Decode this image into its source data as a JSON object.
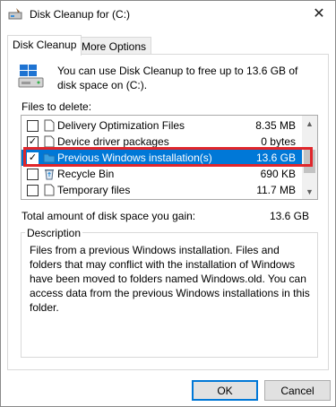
{
  "window": {
    "title": "Disk Cleanup for  (C:)",
    "close_glyph": "✕"
  },
  "tabs": [
    {
      "label": "Disk Cleanup",
      "active": true
    },
    {
      "label": "More Options",
      "active": false
    }
  ],
  "intro": {
    "icon": "disk-cleanup-drive-icon",
    "text": "You can use Disk Cleanup to free up to 13.6 GB of disk space on  (C:)."
  },
  "files_label": "Files to delete:",
  "files": [
    {
      "name": "Delivery Optimization Files",
      "size": "8.35 MB",
      "checked": false,
      "icon": "blank-file-icon",
      "selected": false
    },
    {
      "name": "Device driver packages",
      "size": "0 bytes",
      "checked": true,
      "icon": "blank-file-icon",
      "selected": false
    },
    {
      "name": "Previous Windows installation(s)",
      "size": "13.6 GB",
      "checked": true,
      "icon": "folder-icon",
      "selected": true
    },
    {
      "name": "Recycle Bin",
      "size": "690 KB",
      "checked": false,
      "icon": "recycle-bin-icon",
      "selected": false
    },
    {
      "name": "Temporary files",
      "size": "11.7 MB",
      "checked": false,
      "icon": "blank-file-icon",
      "selected": false
    }
  ],
  "check_glyph": "✓",
  "scroll": {
    "up_glyph": "▲",
    "down_glyph": "▼"
  },
  "total": {
    "label": "Total amount of disk space you gain:",
    "value": "13.6 GB"
  },
  "description": {
    "legend": "Description",
    "text": "Files from a previous Windows installation.  Files and folders that may conflict with the installation of Windows have been moved to folders named Windows.old.  You can access data from the previous Windows installations in this folder."
  },
  "buttons": {
    "ok": "OK",
    "cancel": "Cancel"
  },
  "colors": {
    "selection": "#0078d7",
    "highlight_box": "#e0262b"
  }
}
